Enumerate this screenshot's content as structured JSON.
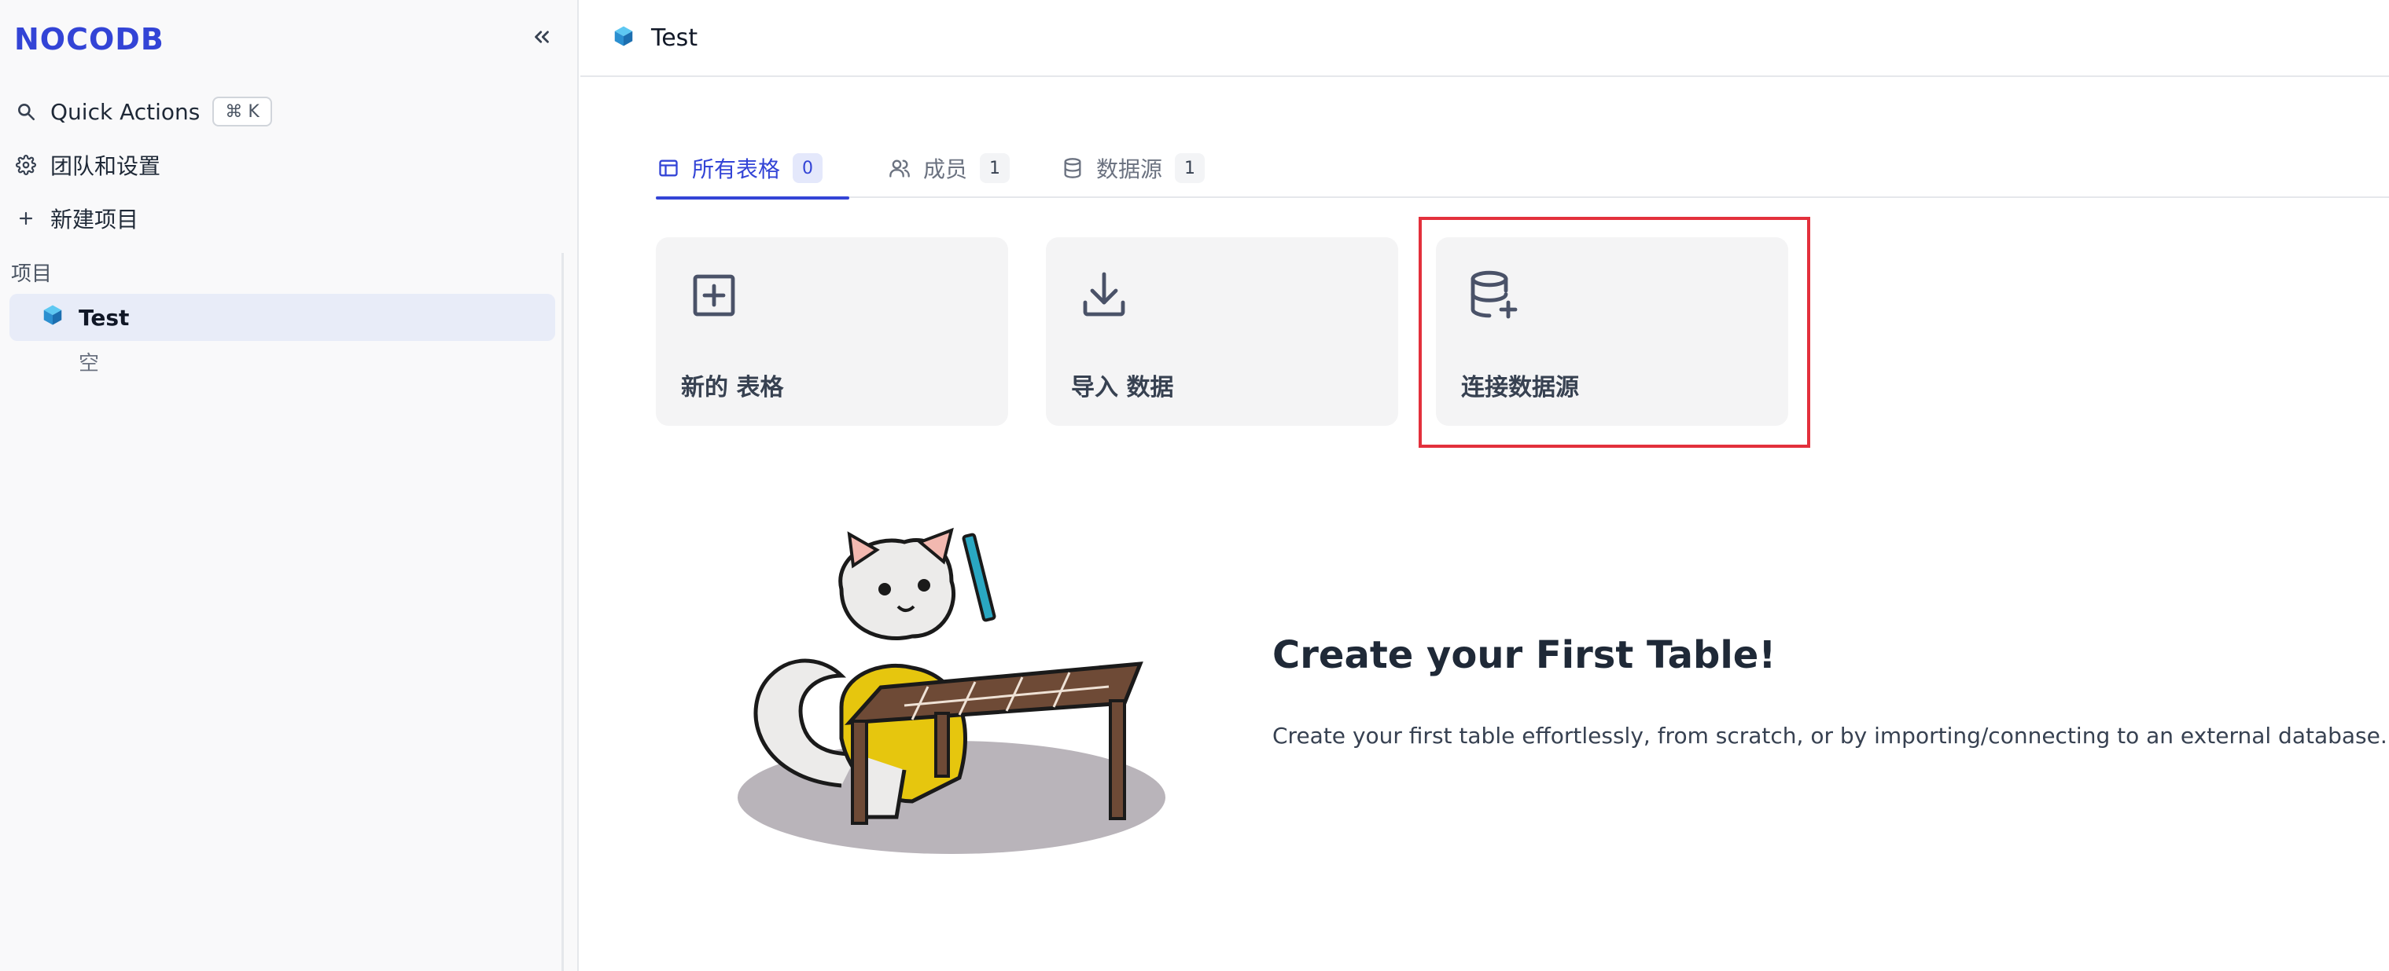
{
  "sidebar": {
    "logo": "NOCODB",
    "quick_actions": {
      "label": "Quick Actions",
      "shortcut": "⌘ K"
    },
    "team_settings_label": "团队和设置",
    "new_project_label": "新建项目",
    "projects_section_label": "项目",
    "projects": [
      {
        "name": "Test",
        "icon": "cube-icon",
        "empty_label": "空"
      }
    ]
  },
  "topbar": {
    "project_title": "Test"
  },
  "tabs": [
    {
      "label": "所有表格",
      "count": "0",
      "icon": "table-icon",
      "active": true
    },
    {
      "label": "成员",
      "count": "1",
      "icon": "users-icon",
      "active": false
    },
    {
      "label": "数据源",
      "count": "1",
      "icon": "database-icon",
      "active": false
    }
  ],
  "actions": [
    {
      "label": "新的 表格",
      "icon": "plus-square-icon"
    },
    {
      "label": "导入 数据",
      "icon": "download-icon"
    },
    {
      "label": "连接数据源",
      "icon": "database-plus-icon"
    }
  ],
  "empty_state": {
    "title": "Create your First Table!",
    "description": "Create your first table effortlessly, from scratch, or by importing/connecting to an external database."
  },
  "colors": {
    "accent": "#3344d6",
    "highlight_border": "#e3303c",
    "sidebar_bg": "#f9f9fa",
    "card_bg": "#f4f4f5"
  }
}
